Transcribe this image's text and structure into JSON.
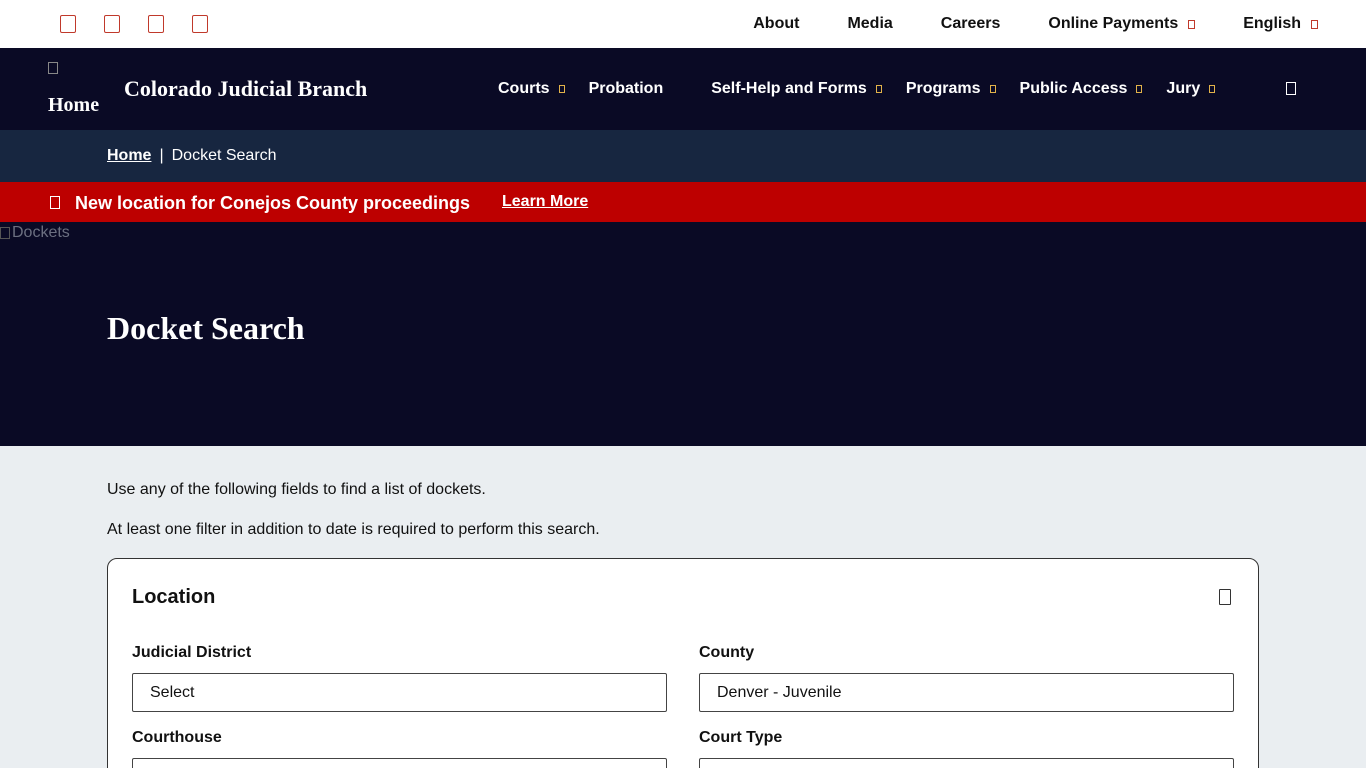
{
  "utility_bar": {
    "social_icons": [
      "facebook-icon",
      "twitter-icon",
      "youtube-icon",
      "linkedin-icon"
    ],
    "links": [
      {
        "label": "About",
        "has_caret": false
      },
      {
        "label": "Media",
        "has_caret": false
      },
      {
        "label": "Careers",
        "has_caret": false
      },
      {
        "label": "Online Payments",
        "has_caret": true
      },
      {
        "label": "English",
        "has_caret": true
      }
    ]
  },
  "header": {
    "logo_alt": "Home",
    "site_title": "Colorado Judicial Branch",
    "nav": [
      {
        "label": "Courts",
        "has_caret": true
      },
      {
        "label": "Probation",
        "has_caret": false
      },
      {
        "label": "Self-Help and Forms",
        "has_caret": true
      },
      {
        "label": "Programs",
        "has_caret": true
      },
      {
        "label": "Public Access",
        "has_caret": true
      },
      {
        "label": "Jury",
        "has_caret": true
      }
    ]
  },
  "breadcrumb": {
    "home": "Home",
    "separator": "|",
    "current": "Docket Search"
  },
  "alert": {
    "text": "New location for Conejos County proceedings",
    "link": "Learn More"
  },
  "hero": {
    "image_alt": "Dockets",
    "title": "Docket Search"
  },
  "main": {
    "intro_line1": "Use any of the following fields to find a list of dockets.",
    "intro_line2": "At least one filter in addition to date is required to perform this search.",
    "location_card": {
      "title": "Location",
      "judicial_district_label": "Judicial District",
      "judicial_district_value": "Select",
      "county_label": "County",
      "county_value": "Denver - Juvenile",
      "courthouse_label": "Courthouse",
      "court_type_label": "Court Type"
    }
  },
  "colors": {
    "navy": "#0a0a25",
    "breadcrumb_bg": "#172640",
    "alert_red": "#bd0000",
    "accent_gold": "#e2b24a",
    "page_bg": "#eaeef1"
  }
}
